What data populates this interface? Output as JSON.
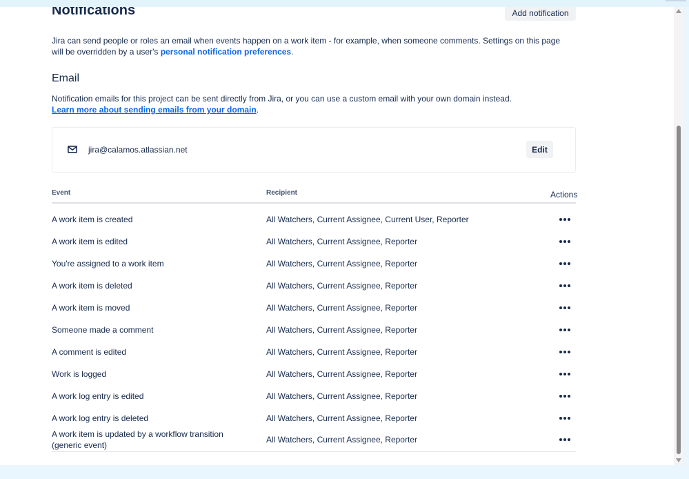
{
  "header": {
    "title": "Notifications",
    "add_label": "Add notification"
  },
  "intro": {
    "text": "Jira can send people or roles an email when events happen on a work item - for example, when someone comments. Settings on this page will be overridden by a user's ",
    "link": "personal notification preferences",
    "suffix": "."
  },
  "email": {
    "title": "Email",
    "description": "Notification emails for this project can be sent directly from Jira, or you can use a custom email with your own domain instead.",
    "learn_link": "Learn more about sending emails from your domain",
    "learn_suffix": ".",
    "address": "jira@calamos.atlassian.net",
    "edit_label": "Edit",
    "icon": "mail-icon"
  },
  "table": {
    "headers": {
      "event": "Event",
      "recipient": "Recipient",
      "actions": "Actions"
    },
    "rows": [
      {
        "event": "A work item is created",
        "recipient": "All Watchers, Current Assignee, Current User, Reporter"
      },
      {
        "event": "A work item is edited",
        "recipient": "All Watchers, Current Assignee, Reporter"
      },
      {
        "event": "You're assigned to a work item",
        "recipient": "All Watchers, Current Assignee, Reporter"
      },
      {
        "event": "A work item is deleted",
        "recipient": "All Watchers, Current Assignee, Reporter"
      },
      {
        "event": "A work item is moved",
        "recipient": "All Watchers, Current Assignee, Reporter"
      },
      {
        "event": "Someone made a comment",
        "recipient": "All Watchers, Current Assignee, Reporter"
      },
      {
        "event": "A comment is edited",
        "recipient": "All Watchers, Current Assignee, Reporter"
      },
      {
        "event": "Work is logged",
        "recipient": "All Watchers, Current Assignee, Reporter"
      },
      {
        "event": "A work log entry is edited",
        "recipient": "All Watchers, Current Assignee, Reporter"
      },
      {
        "event": "A work log entry is deleted",
        "recipient": "All Watchers, Current Assignee, Reporter"
      },
      {
        "event": "A work item is updated by a workflow transition (generic event)",
        "recipient": "All Watchers, Current Assignee, Reporter"
      }
    ]
  },
  "colors": {
    "link": "#0c66e4",
    "text": "#172b4d",
    "button_bg": "#f1f2f4"
  }
}
